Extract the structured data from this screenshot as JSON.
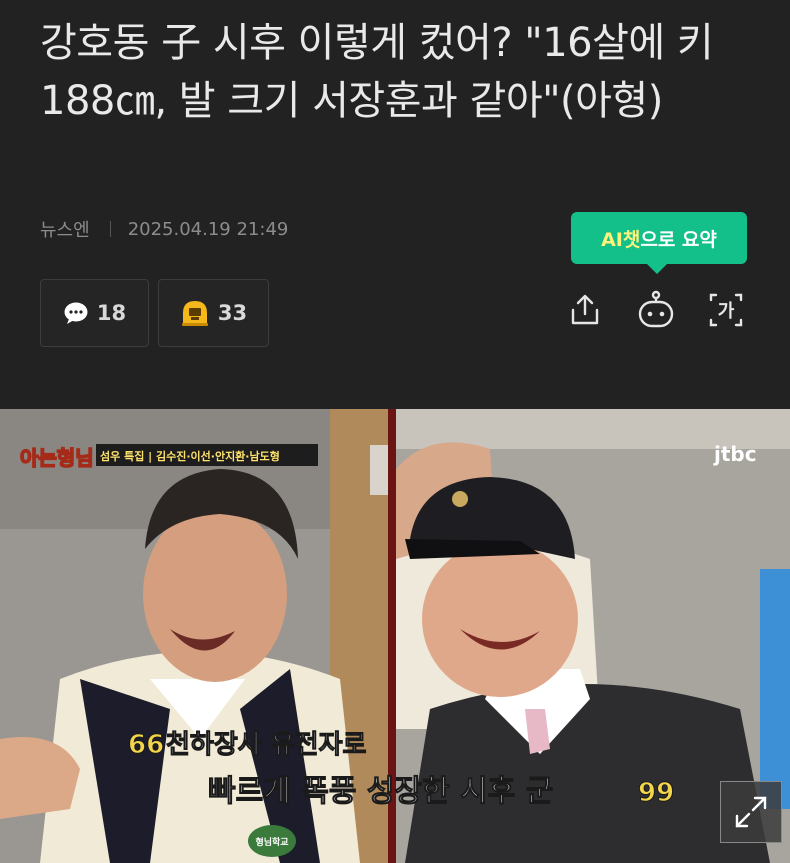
{
  "article": {
    "title": "강호동 子 시후 이렇게 컸어? \"16살에 키 188㎝, 발 크기 서장훈과 같아\"(아형)",
    "source": "뉴스엔",
    "datetime": "2025.04.19 21:49"
  },
  "actions": {
    "comment_count": "18",
    "reaction_count": "33",
    "ai_tooltip_prefix": "AI챗",
    "ai_tooltip_suffix": "으로 요약",
    "share_icon": "share-icon",
    "robot_icon": "ai-robot-icon",
    "fontsize_label": "가"
  },
  "image": {
    "show_logo": "아는형님",
    "banner": "섬우 특집 | 김수진·이선·안지환·남도형",
    "broadcaster": "jtbc",
    "caption_line1": "천하장사 유전자로",
    "caption_line2": "빠르게 폭풍 성장한 시후 군",
    "quote_open": "66",
    "quote_close": "99",
    "badge": "형님학교"
  },
  "colors": {
    "background": "#222222",
    "ai_green": "#14c08a",
    "caption_yellow": "#f2d54a"
  }
}
